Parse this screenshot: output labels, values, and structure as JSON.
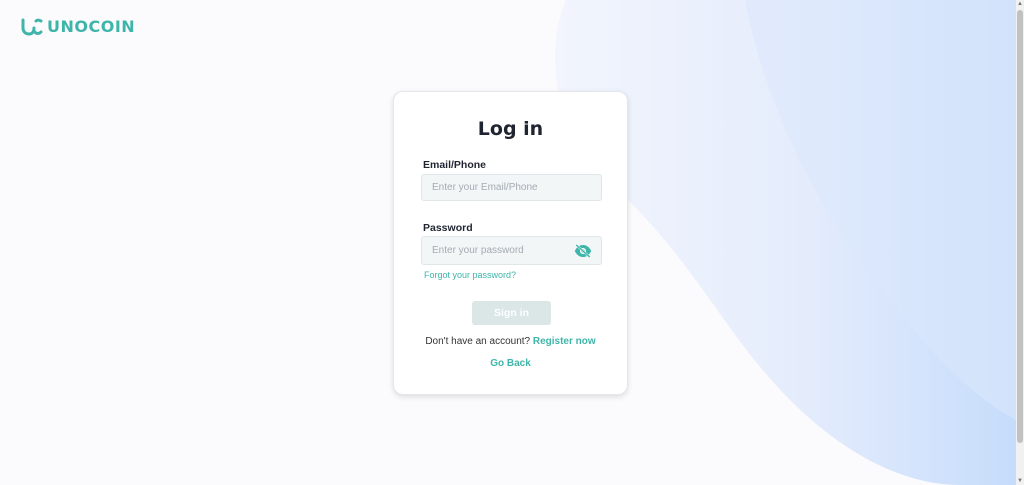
{
  "brand": {
    "name": "UNOCOIN",
    "color": "#3fb5aa"
  },
  "login": {
    "title": "Log in",
    "email_label": "Email/Phone",
    "email_placeholder": "Enter your Email/Phone",
    "email_value": "",
    "password_label": "Password",
    "password_placeholder": "Enter your password",
    "password_value": "",
    "toggle_icon": "eye-off-icon",
    "forgot_label": "Forgot your password?",
    "signin_label": "Sign in",
    "no_account_text": "Don't have an account?",
    "register_label": "Register now",
    "goback_label": "Go Back"
  },
  "colors": {
    "accent": "#3fb5aa",
    "signin_disabled_bg": "#dbe6e6",
    "background_wave": "#e6effd"
  }
}
